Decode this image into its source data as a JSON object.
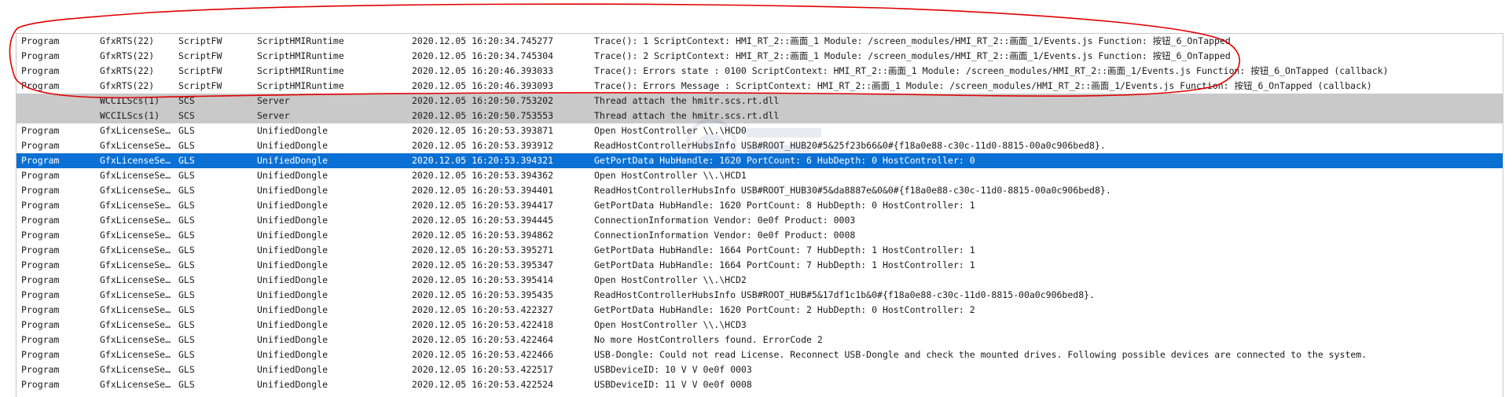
{
  "colors": {
    "selection": "#0a70d4",
    "grey_row": "#c9c9c9",
    "annotation": "#e00000"
  },
  "rows": [
    {
      "type": "Program",
      "process": "GfxRTS(22)",
      "category": "ScriptFW",
      "component": "ScriptHMIRuntime",
      "timestamp": "2020.12.05 16:20:34.745277",
      "message": "Trace(): 1 ScriptContext: HMI_RT_2::画面_1 Module: /screen_modules/HMI_RT_2::画面_1/Events.js Function: 按钮_6_OnTapped",
      "style": "normal"
    },
    {
      "type": "Program",
      "process": "GfxRTS(22)",
      "category": "ScriptFW",
      "component": "ScriptHMIRuntime",
      "timestamp": "2020.12.05 16:20:34.745304",
      "message": "Trace(): 2 ScriptContext: HMI_RT_2::画面_1 Module: /screen_modules/HMI_RT_2::画面_1/Events.js Function: 按钮_6_OnTapped",
      "style": "normal"
    },
    {
      "type": "Program",
      "process": "GfxRTS(22)",
      "category": "ScriptFW",
      "component": "ScriptHMIRuntime",
      "timestamp": "2020.12.05 16:20:46.393033",
      "message": "Trace(): Errors state : 0100 ScriptContext: HMI_RT_2::画面_1 Module: /screen_modules/HMI_RT_2::画面_1/Events.js Function: 按钮_6_OnTapped (callback)",
      "style": "normal"
    },
    {
      "type": "Program",
      "process": "GfxRTS(22)",
      "category": "ScriptFW",
      "component": "ScriptHMIRuntime",
      "timestamp": "2020.12.05 16:20:46.393093",
      "message": "Trace(): Errors Message :  ScriptContext: HMI_RT_2::画面_1 Module: /screen_modules/HMI_RT_2::画面_1/Events.js Function: 按钮_6_OnTapped (callback)",
      "style": "normal"
    },
    {
      "type": "",
      "process": "WCCILScs(1)",
      "category": "SCS",
      "component": "Server",
      "timestamp": "2020.12.05 16:20:50.753202",
      "message": "Thread attach the hmitr.scs.rt.dll",
      "style": "grey"
    },
    {
      "type": "",
      "process": "WCCILScs(1)",
      "category": "SCS",
      "component": "Server",
      "timestamp": "2020.12.05 16:20:50.753553",
      "message": "Thread attach the hmitr.scs.rt.dll",
      "style": "grey"
    },
    {
      "type": "Program",
      "process": "GfxLicenseSe…",
      "category": "GLS",
      "component": "UnifiedDongle",
      "timestamp": "2020.12.05 16:20:53.393871",
      "message": "Open HostController \\\\.\\HCD0",
      "style": "normal"
    },
    {
      "type": "Program",
      "process": "GfxLicenseSe…",
      "category": "GLS",
      "component": "UnifiedDongle",
      "timestamp": "2020.12.05 16:20:53.393912",
      "message": "ReadHostControllerHubsInfo USB#ROOT_HUB20#5&25f23b66&0#{f18a0e88-c30c-11d0-8815-00a0c906bed8}.",
      "style": "normal"
    },
    {
      "type": "Program",
      "process": "GfxLicenseSe…",
      "category": "GLS",
      "component": "UnifiedDongle",
      "timestamp": "2020.12.05 16:20:53.394321",
      "message": "GetPortData HubHandle: 1620 PortCount: 6 HubDepth: 0 HostController: 0",
      "style": "selected"
    },
    {
      "type": "Program",
      "process": "GfxLicenseSe…",
      "category": "GLS",
      "component": "UnifiedDongle",
      "timestamp": "2020.12.05 16:20:53.394362",
      "message": "Open HostController \\\\.\\HCD1",
      "style": "normal"
    },
    {
      "type": "Program",
      "process": "GfxLicenseSe…",
      "category": "GLS",
      "component": "UnifiedDongle",
      "timestamp": "2020.12.05 16:20:53.394401",
      "message": "ReadHostControllerHubsInfo USB#ROOT_HUB30#5&da8887e&0&0#{f18a0e88-c30c-11d0-8815-00a0c906bed8}.",
      "style": "normal"
    },
    {
      "type": "Program",
      "process": "GfxLicenseSe…",
      "category": "GLS",
      "component": "UnifiedDongle",
      "timestamp": "2020.12.05 16:20:53.394417",
      "message": "GetPortData HubHandle: 1620 PortCount: 8 HubDepth: 0 HostController: 1",
      "style": "normal"
    },
    {
      "type": "Program",
      "process": "GfxLicenseSe…",
      "category": "GLS",
      "component": "UnifiedDongle",
      "timestamp": "2020.12.05 16:20:53.394445",
      "message": "ConnectionInformation Vendor: 0e0f Product: 0003",
      "style": "normal"
    },
    {
      "type": "Program",
      "process": "GfxLicenseSe…",
      "category": "GLS",
      "component": "UnifiedDongle",
      "timestamp": "2020.12.05 16:20:53.394862",
      "message": "ConnectionInformation Vendor: 0e0f Product: 0008",
      "style": "normal"
    },
    {
      "type": "Program",
      "process": "GfxLicenseSe…",
      "category": "GLS",
      "component": "UnifiedDongle",
      "timestamp": "2020.12.05 16:20:53.395271",
      "message": "GetPortData HubHandle: 1664 PortCount: 7 HubDepth: 1 HostController: 1",
      "style": "normal"
    },
    {
      "type": "Program",
      "process": "GfxLicenseSe…",
      "category": "GLS",
      "component": "UnifiedDongle",
      "timestamp": "2020.12.05 16:20:53.395347",
      "message": "GetPortData HubHandle: 1664 PortCount: 7 HubDepth: 1 HostController: 1",
      "style": "normal"
    },
    {
      "type": "Program",
      "process": "GfxLicenseSe…",
      "category": "GLS",
      "component": "UnifiedDongle",
      "timestamp": "2020.12.05 16:20:53.395414",
      "message": "Open HostController \\\\.\\HCD2",
      "style": "normal"
    },
    {
      "type": "Program",
      "process": "GfxLicenseSe…",
      "category": "GLS",
      "component": "UnifiedDongle",
      "timestamp": "2020.12.05 16:20:53.395435",
      "message": "ReadHostControllerHubsInfo USB#ROOT_HUB#5&17df1c1b&0#{f18a0e88-c30c-11d0-8815-00a0c906bed8}.",
      "style": "normal"
    },
    {
      "type": "Program",
      "process": "GfxLicenseSe…",
      "category": "GLS",
      "component": "UnifiedDongle",
      "timestamp": "2020.12.05 16:20:53.422327",
      "message": "GetPortData HubHandle: 1620 PortCount: 2 HubDepth: 0 HostController: 2",
      "style": "normal"
    },
    {
      "type": "Program",
      "process": "GfxLicenseSe…",
      "category": "GLS",
      "component": "UnifiedDongle",
      "timestamp": "2020.12.05 16:20:53.422418",
      "message": "Open HostController \\\\.\\HCD3",
      "style": "normal"
    },
    {
      "type": "Program",
      "process": "GfxLicenseSe…",
      "category": "GLS",
      "component": "UnifiedDongle",
      "timestamp": "2020.12.05 16:20:53.422464",
      "message": "No more HostControllers found. ErrorCode 2",
      "style": "normal"
    },
    {
      "type": "Program",
      "process": "GfxLicenseSe…",
      "category": "GLS",
      "component": "UnifiedDongle",
      "timestamp": "2020.12.05 16:20:53.422466",
      "message": "USB-Dongle: Could not read License. Reconnect USB-Dongle and check the mounted drives. Following possible devices are connected to the system.",
      "style": "normal"
    },
    {
      "type": "Program",
      "process": "GfxLicenseSe…",
      "category": "GLS",
      "component": "UnifiedDongle",
      "timestamp": "2020.12.05 16:20:53.422517",
      "message": "USBDeviceID: 10 V V 0e0f 0003",
      "style": "normal"
    },
    {
      "type": "Program",
      "process": "GfxLicenseSe…",
      "category": "GLS",
      "component": "UnifiedDongle",
      "timestamp": "2020.12.05 16:20:53.422524",
      "message": "USBDeviceID: 11 V V 0e0f 0008",
      "style": "normal"
    }
  ]
}
